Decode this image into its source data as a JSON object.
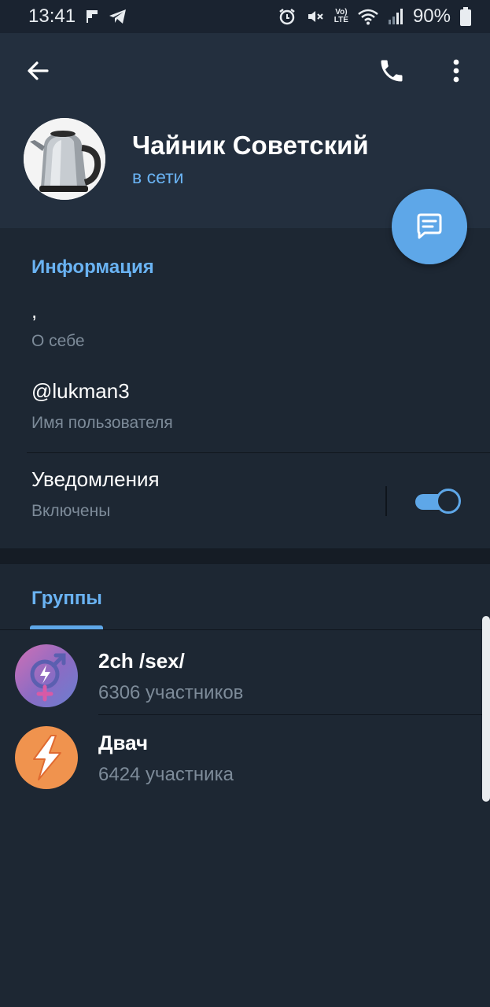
{
  "status_bar": {
    "time": "13:41",
    "battery": "90%",
    "left_icons": [
      "flipboard-icon",
      "telegram-icon"
    ],
    "right_icons": [
      "alarm-icon",
      "mute-icon",
      "volte-icon",
      "wifi-icon",
      "signal-icon",
      "battery-icon"
    ],
    "volte_top": "Vo)",
    "volte_bottom": "LTE"
  },
  "header": {
    "name": "Чайник Советский",
    "status": "в сети",
    "avatar_icon": "kettle-photo",
    "actions": [
      "back-icon",
      "phone-icon",
      "more-icon"
    ]
  },
  "info": {
    "title": "Информация",
    "bio_value": ",",
    "bio_label": "О себе",
    "username_value": "@lukman3",
    "username_label": "Имя пользователя",
    "notifications_label": "Уведомления",
    "notifications_status": "Включены",
    "notifications_on": true
  },
  "groups": {
    "tab_label": "Группы",
    "items": [
      {
        "name": "2ch /sex/",
        "members": "6306 участников",
        "icon": "gender-symbol-icon"
      },
      {
        "name": "Двач",
        "members": "6424 участника",
        "icon": "lightning-icon"
      }
    ]
  },
  "colors": {
    "accent": "#6ab3f3",
    "fab": "#5ea7e8",
    "background": "#1d2733",
    "header": "#232f3e"
  }
}
